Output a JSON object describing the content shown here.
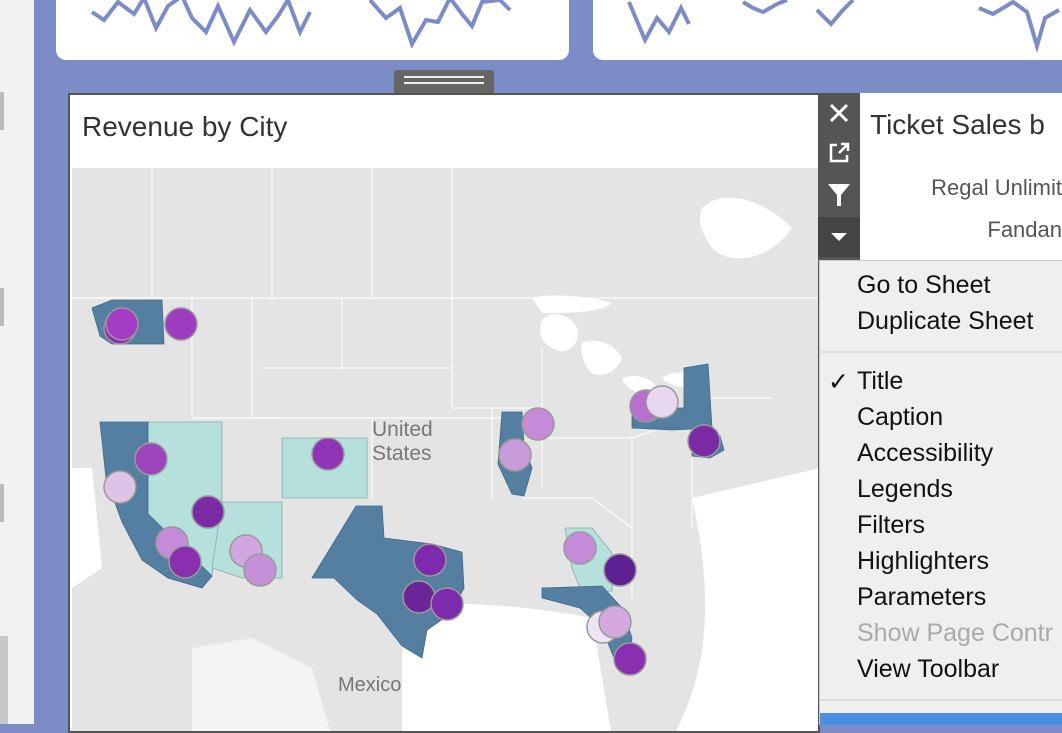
{
  "sheet": {
    "title": "Revenue by City"
  },
  "map_labels": {
    "country_line1": "United",
    "country_line2": "States",
    "mexico": "Mexico"
  },
  "toolbar": {
    "close_icon": "close-icon",
    "open_icon": "external-link-icon",
    "filter_icon": "filter-icon",
    "more_icon": "chevron-down-icon"
  },
  "right_card": {
    "title": "Ticket Sales b",
    "rows": [
      "Regal Unlimit",
      "Fandan"
    ]
  },
  "context_menu": {
    "group1": [
      "Go to Sheet",
      "Duplicate Sheet"
    ],
    "group2": [
      {
        "label": "Title",
        "checked": true,
        "disabled": false
      },
      {
        "label": "Caption",
        "checked": false,
        "disabled": false
      },
      {
        "label": "Accessibility",
        "checked": false,
        "disabled": false
      },
      {
        "label": "Legends",
        "checked": false,
        "disabled": false
      },
      {
        "label": "Filters",
        "checked": false,
        "disabled": false
      },
      {
        "label": "Highlighters",
        "checked": false,
        "disabled": false
      },
      {
        "label": "Parameters",
        "checked": false,
        "disabled": false
      },
      {
        "label": "Show Page Contr",
        "checked": false,
        "disabled": true
      },
      {
        "label": "View Toolbar",
        "checked": false,
        "disabled": false
      }
    ],
    "check_glyph": "✓"
  },
  "colors": {
    "dashboard_bg": "#7b8cc7",
    "spark_line": "#7b8cc7",
    "state_dark": "#557fa0",
    "state_light": "#b6e0dc",
    "land": "#e4e4e4",
    "water": "#ffffff",
    "menu_bg": "#efefef",
    "toolbar_bg": "#555555"
  }
}
